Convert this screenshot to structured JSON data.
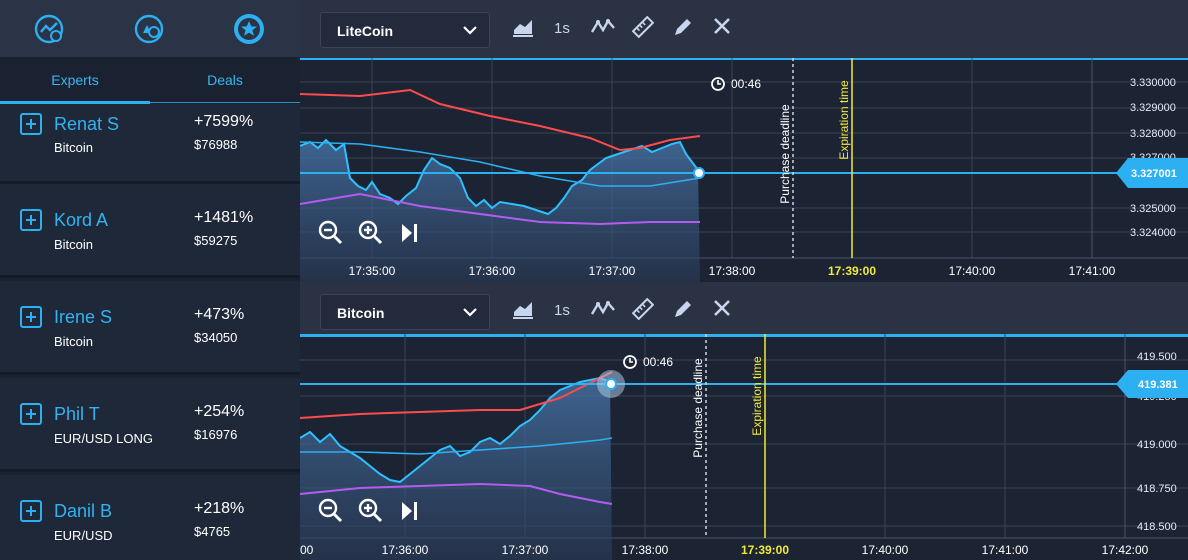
{
  "left_panel": {
    "top_icons": [
      "analytics-icon",
      "assets-icon",
      "star-badge-icon"
    ],
    "tabs": {
      "experts": "Experts",
      "deals": "Deals"
    },
    "experts": [
      {
        "name": "Renat S",
        "asset": "Bitcoin",
        "percent": "+7599%",
        "amount": "$76988"
      },
      {
        "name": "Kord A",
        "asset": "Bitcoin",
        "percent": "+1481%",
        "amount": "$59275"
      },
      {
        "name": "Irene S",
        "asset": "Bitcoin",
        "percent": "+473%",
        "amount": "$34050"
      },
      {
        "name": "Phil T",
        "asset": "EUR/USD LONG",
        "percent": "+254%",
        "amount": "$16976"
      },
      {
        "name": "Danil B",
        "asset": "EUR/USD",
        "percent": "+218%",
        "amount": "$4765"
      }
    ]
  },
  "charts": [
    {
      "asset_select": "LiteCoin",
      "interval": "1s",
      "timer": "00:46",
      "purchase_deadline_label": "Purchase deadline",
      "expiration_label": "Expiration time",
      "current_price": "3.327001",
      "price_ticks": [
        "3.330000",
        "3.329000",
        "3.328000",
        "3.327000",
        "3.325000",
        "3.324000"
      ],
      "time_ticks": [
        "17:35:00",
        "17:36:00",
        "17:37:00",
        "17:38:00",
        "17:39:00",
        "17:40:00",
        "17:41:00"
      ]
    },
    {
      "asset_select": "Bitcoin",
      "interval": "1s",
      "timer": "00:46",
      "purchase_deadline_label": "Purchase deadline",
      "expiration_label": "Expiration time",
      "current_price": "419.381",
      "price_ticks": [
        "419.500",
        "419.250",
        "419.000",
        "418.750",
        "418.500"
      ],
      "time_ticks": [
        "00",
        "17:36:00",
        "17:37:00",
        "17:38:00",
        "17:39:00",
        "17:40:00",
        "17:41:00",
        "17:42:00"
      ]
    }
  ],
  "colors": {
    "accent": "#2cb0f2",
    "red_line": "#ff4b4b",
    "purple_line": "#b45cf0",
    "expiration": "#f0ea3a",
    "panel_bg": "#1a2232",
    "chart_bg": "#1c2333"
  }
}
